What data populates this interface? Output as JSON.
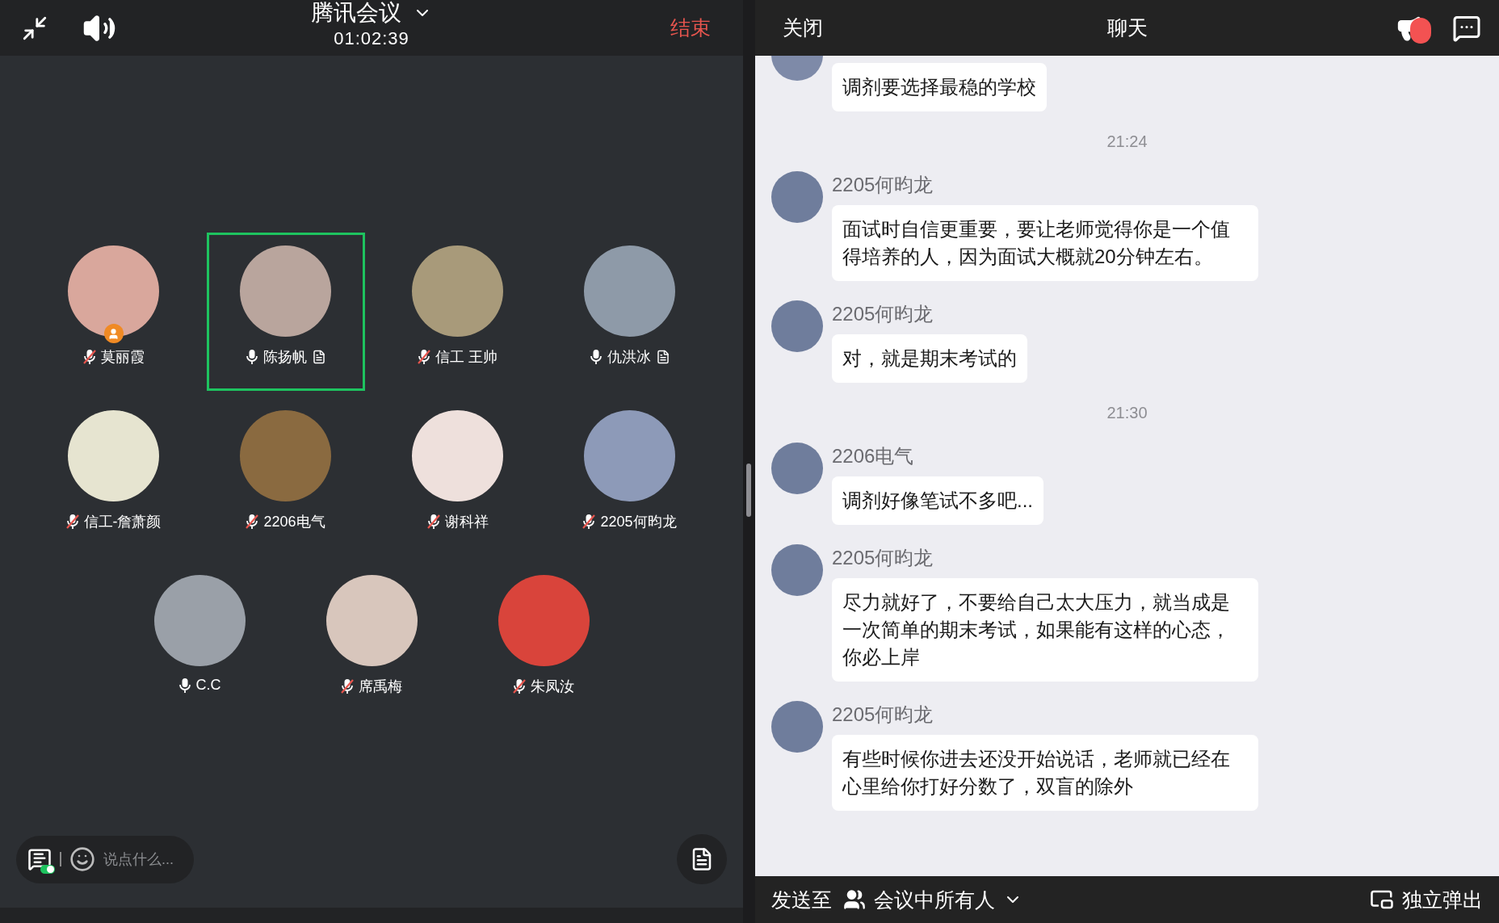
{
  "meeting": {
    "title": "腾讯会议",
    "elapsed": "01:02:39",
    "end_label": "结束"
  },
  "participants": [
    {
      "name": "莫丽霞",
      "muted": true,
      "host": true,
      "note": false,
      "selected": false
    },
    {
      "name": "陈扬帆",
      "muted": false,
      "host": false,
      "note": true,
      "selected": true
    },
    {
      "name": "信工 王帅",
      "muted": true,
      "host": false,
      "note": false,
      "selected": false
    },
    {
      "name": "仇洪冰",
      "muted": false,
      "host": false,
      "note": true,
      "selected": false
    },
    {
      "name": "信工-詹萧颜",
      "muted": true,
      "host": false,
      "note": false,
      "selected": false
    },
    {
      "name": "2206电气",
      "muted": true,
      "host": false,
      "note": false,
      "selected": false
    },
    {
      "name": "谢科祥",
      "muted": true,
      "host": false,
      "note": false,
      "selected": false
    },
    {
      "name": "2205何昀龙",
      "muted": true,
      "host": false,
      "note": false,
      "selected": false
    },
    {
      "name": "C.C",
      "muted": false,
      "host": false,
      "note": false,
      "selected": false
    },
    {
      "name": "席禹梅",
      "muted": true,
      "host": false,
      "note": false,
      "selected": false
    },
    {
      "name": "朱凤汝",
      "muted": true,
      "host": false,
      "note": false,
      "selected": false
    }
  ],
  "composer": {
    "placeholder": "说点什么...",
    "captions_on": true
  },
  "chat": {
    "close_label": "关闭",
    "title": "聊天",
    "notice": true,
    "items": [
      {
        "kind": "message",
        "text": "调剂要选择最稳的学校"
      },
      {
        "kind": "time",
        "text": "21:24"
      },
      {
        "kind": "message",
        "name": "2205何昀龙",
        "text": "面试时自信更重要，要让老师觉得你是一个值得培养的人，因为面试大概就20分钟左右。"
      },
      {
        "kind": "message",
        "name": "2205何昀龙",
        "text": "对，就是期末考试的"
      },
      {
        "kind": "time",
        "text": "21:30"
      },
      {
        "kind": "message",
        "name": "2206电气",
        "text": "调剂好像笔试不多吧..."
      },
      {
        "kind": "message",
        "name": "2205何昀龙",
        "text": "尽力就好了，不要给自己太大压力，就当成是一次简单的期末考试，如果能有这样的心态，你必上岸"
      },
      {
        "kind": "message",
        "name": "2205何昀龙",
        "text": "有些时候你进去还没开始说话，老师就已经在心里给你打好分数了，双盲的除外"
      }
    ],
    "send_label": "发送至",
    "send_target": "会议中所有人",
    "popout_label": "独立弹出"
  }
}
